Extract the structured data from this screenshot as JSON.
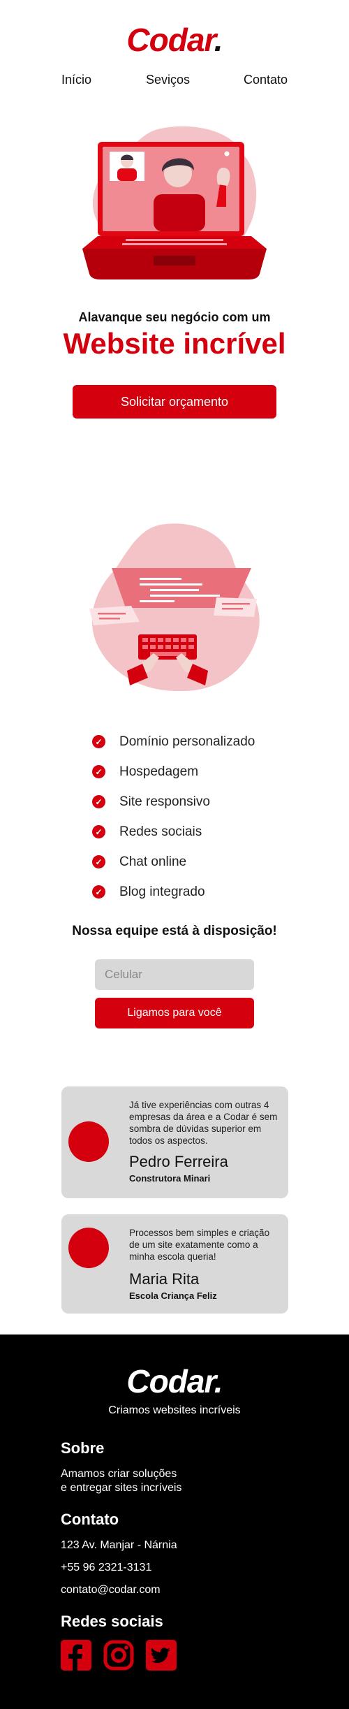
{
  "brand": {
    "name": "Codar",
    "dot": ".",
    "accent": "#d4000e"
  },
  "nav": {
    "items": [
      "Início",
      "Seviços",
      "Contato"
    ]
  },
  "hero": {
    "subtitle": "Alavanque seu negócio com um",
    "title": "Website incrível",
    "cta_label": "Solicitar orçamento",
    "illustration_icon": "laptop-video-call-icon"
  },
  "services": {
    "illustration_icon": "code-editor-keyboard-icon",
    "features": [
      "Domínio personalizado",
      "Hospedagem",
      "Site responsivo",
      "Redes sociais",
      "Chat online",
      "Blog integrado"
    ]
  },
  "contact_form": {
    "title": "Nossa equipe está à disposição!",
    "phone_placeholder": "Celular",
    "button_label": "Ligamos para você"
  },
  "testimonials": [
    {
      "quote": "Já tive experiências com outras 4 empresas da área e a Codar é sem sombra de dúvidas superior em todos os aspectos.",
      "name": "Pedro Ferreira",
      "company": "Construtora Minari"
    },
    {
      "quote": "Processos bem simples e criação de um site exatamente como a minha escola queria!",
      "name": "Maria Rita",
      "company": "Escola Criança Feliz"
    }
  ],
  "footer": {
    "logo": "Codar.",
    "tagline": "Criamos websites incríveis",
    "about_title": "Sobre",
    "about_line1": "Amamos criar soluções",
    "about_line2": "e entregar sites incríveis",
    "contact_title": "Contato",
    "address": "123 Av. Manjar - Nárnia",
    "phone": "+55 96 2321-3131",
    "email": "contato@codar.com",
    "social_title": "Redes sociais",
    "social_icons": [
      "facebook-icon",
      "instagram-icon",
      "twitter-icon"
    ]
  }
}
